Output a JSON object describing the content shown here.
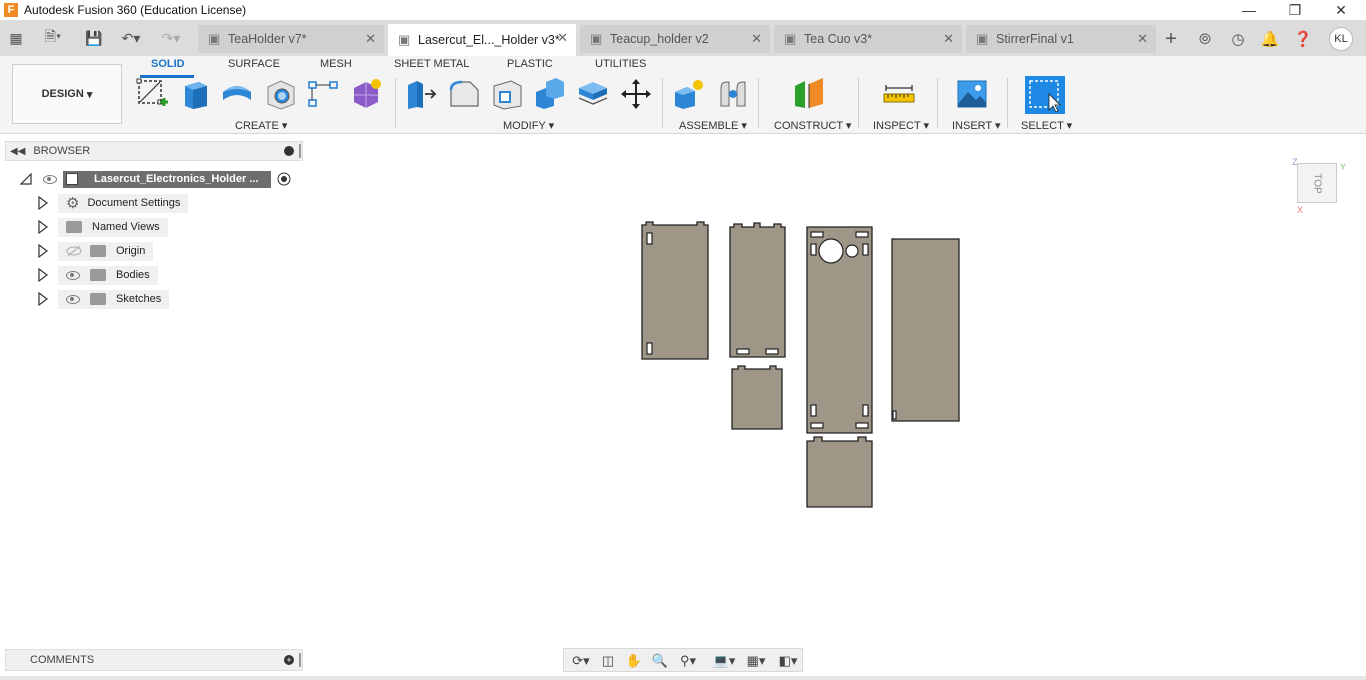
{
  "window": {
    "title": "Autodesk Fusion 360 (Education License)",
    "app_icon_letter": "F",
    "controls": [
      "minimize-icon",
      "maximize-icon",
      "close-icon"
    ]
  },
  "tabs": [
    {
      "label": "TeaHolder v7*",
      "active": false
    },
    {
      "label": "Lasercut_El..._Holder v3*",
      "active": true
    },
    {
      "label": "Teacup_holder v2",
      "active": false
    },
    {
      "label": "Tea Cuo v3*",
      "active": false
    },
    {
      "label": "StirrerFinal v1",
      "active": false
    }
  ],
  "user": {
    "initials": "KL"
  },
  "toolbar": {
    "workspace": "DESIGN",
    "tabs": [
      "SOLID",
      "SURFACE",
      "MESH",
      "SHEET METAL",
      "PLASTIC",
      "UTILITIES"
    ],
    "active_tab": "SOLID",
    "groups": {
      "create": "CREATE",
      "modify": "MODIFY",
      "assemble": "ASSEMBLE",
      "construct": "CONSTRUCT",
      "inspect": "INSPECT",
      "insert": "INSERT",
      "select": "SELECT"
    },
    "accent": "#1a73c8"
  },
  "browser": {
    "title": "BROWSER",
    "root": "Lasercut_Electronics_Holder ...",
    "items": [
      {
        "label": "Document Settings",
        "icon": "gear-icon",
        "visible_toggle": false
      },
      {
        "label": "Named Views",
        "icon": "folder-icon",
        "visible_toggle": false
      },
      {
        "label": "Origin",
        "icon": "folder-icon",
        "visible_toggle": "hidden"
      },
      {
        "label": "Bodies",
        "icon": "folder-icon",
        "visible_toggle": true
      },
      {
        "label": "Sketches",
        "icon": "folder-icon",
        "visible_toggle": true
      }
    ]
  },
  "comments": {
    "title": "COMMENTS"
  },
  "viewcube": {
    "face": "TOP",
    "axes": [
      "Z",
      "Y",
      "X"
    ]
  },
  "canvas": {
    "part_color": "#9e9686",
    "edge_color": "#222222"
  }
}
